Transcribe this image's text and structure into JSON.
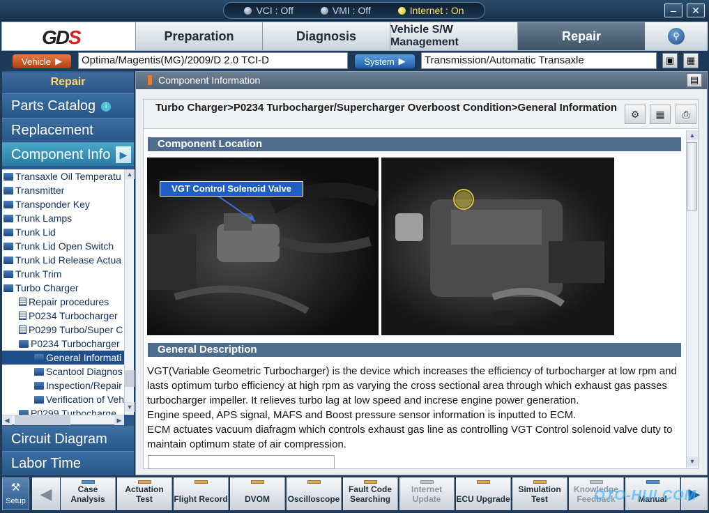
{
  "status": {
    "vci": "VCI : Off",
    "vmi": "VMI : Off",
    "internet": "Internet : On"
  },
  "window": {
    "minimize": "–",
    "close": "✕"
  },
  "logo": {
    "text_gd": "GD",
    "text_s": "S"
  },
  "tabs": [
    {
      "label": "Preparation"
    },
    {
      "label": "Diagnosis"
    },
    {
      "label": "Vehicle S/W Management"
    },
    {
      "label": "Repair"
    }
  ],
  "vehicle": {
    "button_label": "Vehicle",
    "value": "Optima/Magentis(MG)/2009/D 2.0 TCI-D",
    "system_button_label": "System",
    "system_value": "Transmission/Automatic Transaxle"
  },
  "sidebar": {
    "title": "Repair",
    "buttons": [
      {
        "label": "Parts Catalog"
      },
      {
        "label": "Replacement"
      },
      {
        "label": "Component Info"
      }
    ],
    "bottom_buttons": [
      {
        "label": "Circuit Diagram"
      },
      {
        "label": "Labor Time"
      }
    ],
    "tree": [
      {
        "label": "Transaxle Oil Temperatu",
        "indent": 0,
        "icon": "folder",
        "selected": false
      },
      {
        "label": "Transmitter",
        "indent": 0,
        "icon": "folder",
        "selected": false
      },
      {
        "label": "Transponder Key",
        "indent": 0,
        "icon": "folder",
        "selected": false
      },
      {
        "label": "Trunk Lamps",
        "indent": 0,
        "icon": "folder",
        "selected": false
      },
      {
        "label": "Trunk Lid",
        "indent": 0,
        "icon": "folder",
        "selected": false
      },
      {
        "label": "Trunk Lid Open Switch",
        "indent": 0,
        "icon": "folder",
        "selected": false
      },
      {
        "label": "Trunk Lid Release Actua",
        "indent": 0,
        "icon": "folder",
        "selected": false
      },
      {
        "label": "Trunk Trim",
        "indent": 0,
        "icon": "folder",
        "selected": false
      },
      {
        "label": "Turbo Charger",
        "indent": 0,
        "icon": "folder",
        "selected": false
      },
      {
        "label": "Repair procedures",
        "indent": 1,
        "icon": "doc",
        "selected": false
      },
      {
        "label": "P0234 Turbocharger",
        "indent": 1,
        "icon": "doc",
        "selected": false
      },
      {
        "label": "P0299 Turbo/Super C",
        "indent": 1,
        "icon": "doc",
        "selected": false
      },
      {
        "label": "P0234 Turbocharger",
        "indent": 1,
        "icon": "folder",
        "selected": false
      },
      {
        "label": "General Informati",
        "indent": 2,
        "icon": "folder",
        "selected": true
      },
      {
        "label": "Scantool Diagnos",
        "indent": 2,
        "icon": "folder",
        "selected": false
      },
      {
        "label": "Inspection/Repair",
        "indent": 2,
        "icon": "folder",
        "selected": false
      },
      {
        "label": "Verification of Veh",
        "indent": 2,
        "icon": "folder",
        "selected": false
      },
      {
        "label": "P0299 Turbocharge",
        "indent": 1,
        "icon": "folder",
        "selected": false
      }
    ]
  },
  "main": {
    "header": "Component Information",
    "title": "Turbo Charger>P0234 Turbocharger/Supercharger Overboost Condition>General Information",
    "sections": {
      "location": "Component Location",
      "description": "General Description"
    },
    "callout": "VGT Control Solenoid Valve",
    "paragraphs": [
      "VGT(Variable Geometric Turbocharger) is the device which increases the efficiency of turbocharger at low rpm and lasts optimum turbo efficiency at high rpm as varying the cross sectional area through which exhaust gas passes turbocharger impeller. It relieves turbo lag at low speed and increse engine power generation.",
      "Engine speed, APS signal, MAFS and Boost pressure sensor information is inputted to ECM.",
      "ECM actuates vacuum diafragm which controls exhaust gas line as controlling VGT Control solenoid valve duty to maintain optimum state of air compression."
    ]
  },
  "bottom": {
    "setup_label": "Setup",
    "functions": [
      {
        "label": "Case Analysis",
        "dim": false,
        "ind": "blue"
      },
      {
        "label": "Actuation Test",
        "dim": false,
        "ind": "orange"
      },
      {
        "label": "Flight Record",
        "dim": false,
        "ind": "orange"
      },
      {
        "label": "DVOM",
        "dim": false,
        "ind": "orange"
      },
      {
        "label": "Oscilloscope",
        "dim": false,
        "ind": "orange"
      },
      {
        "label": "Fault Code Searching",
        "dim": false,
        "ind": "orange"
      },
      {
        "label": "Internet Update",
        "dim": true,
        "ind": "grey"
      },
      {
        "label": "ECU Upgrade",
        "dim": false,
        "ind": "orange"
      },
      {
        "label": "Simulation Test",
        "dim": false,
        "ind": "orange"
      },
      {
        "label": "Knowledge Feedback",
        "dim": true,
        "ind": "grey"
      },
      {
        "label": "Manual",
        "dim": false,
        "ind": "blue"
      }
    ]
  },
  "watermark": "OTO-HUI.COM"
}
